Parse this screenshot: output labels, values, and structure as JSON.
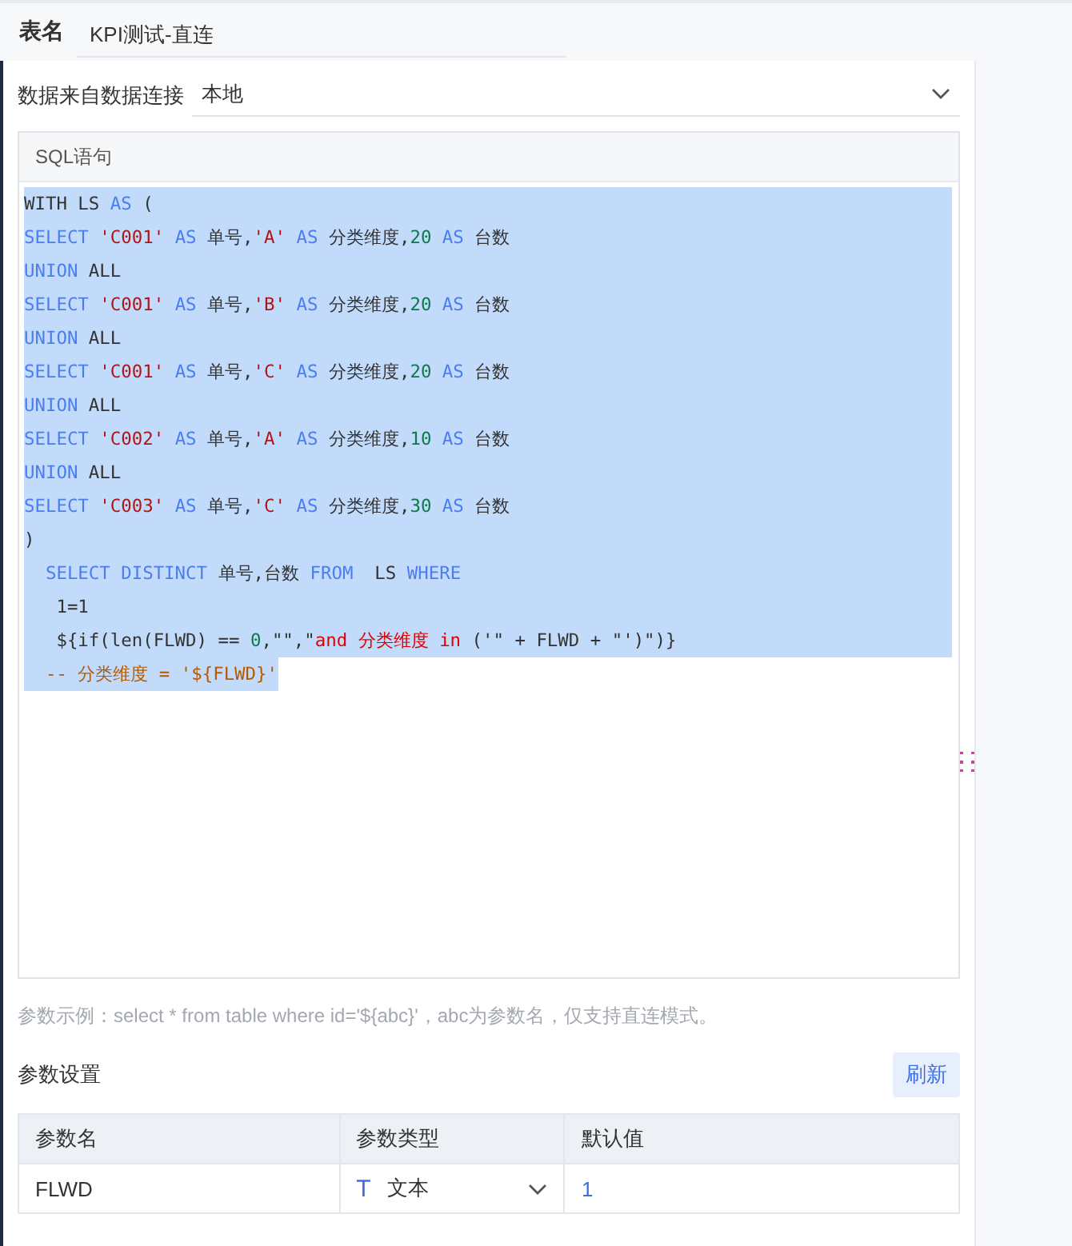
{
  "header": {
    "label": "表名",
    "value": "KPI测试-直连"
  },
  "connection": {
    "label": "数据来自数据连接",
    "value": "本地"
  },
  "sql": {
    "title": "SQL语句",
    "lines": [
      {
        "selected": true,
        "tokens": [
          {
            "color": "#333333",
            "text": "WITH LS "
          },
          {
            "color": "#4a7ef0",
            "text": "AS "
          },
          {
            "color": "#333333",
            "text": "("
          }
        ]
      },
      {
        "selected": true,
        "tokens": [
          {
            "color": "#4a7ef0",
            "text": "SELECT "
          },
          {
            "color": "#b01414",
            "text": "'C001' "
          },
          {
            "color": "#4a7ef0",
            "text": "AS "
          },
          {
            "color": "#333333",
            "text": "单号,"
          },
          {
            "color": "#b01414",
            "text": "'A' "
          },
          {
            "color": "#4a7ef0",
            "text": "AS "
          },
          {
            "color": "#333333",
            "text": "分类维度,"
          },
          {
            "color": "#0a7a4a",
            "text": "20 "
          },
          {
            "color": "#4a7ef0",
            "text": "AS "
          },
          {
            "color": "#333333",
            "text": "台数"
          }
        ]
      },
      {
        "selected": true,
        "tokens": [
          {
            "color": "#4a7ef0",
            "text": "UNION "
          },
          {
            "color": "#333333",
            "text": "ALL"
          }
        ]
      },
      {
        "selected": true,
        "tokens": [
          {
            "color": "#4a7ef0",
            "text": "SELECT "
          },
          {
            "color": "#b01414",
            "text": "'C001' "
          },
          {
            "color": "#4a7ef0",
            "text": "AS "
          },
          {
            "color": "#333333",
            "text": "单号,"
          },
          {
            "color": "#b01414",
            "text": "'B' "
          },
          {
            "color": "#4a7ef0",
            "text": "AS "
          },
          {
            "color": "#333333",
            "text": "分类维度,"
          },
          {
            "color": "#0a7a4a",
            "text": "20 "
          },
          {
            "color": "#4a7ef0",
            "text": "AS "
          },
          {
            "color": "#333333",
            "text": "台数"
          }
        ]
      },
      {
        "selected": true,
        "tokens": [
          {
            "color": "#4a7ef0",
            "text": "UNION "
          },
          {
            "color": "#333333",
            "text": "ALL"
          }
        ]
      },
      {
        "selected": true,
        "tokens": [
          {
            "color": "#4a7ef0",
            "text": "SELECT "
          },
          {
            "color": "#b01414",
            "text": "'C001' "
          },
          {
            "color": "#4a7ef0",
            "text": "AS "
          },
          {
            "color": "#333333",
            "text": "单号,"
          },
          {
            "color": "#b01414",
            "text": "'C' "
          },
          {
            "color": "#4a7ef0",
            "text": "AS "
          },
          {
            "color": "#333333",
            "text": "分类维度,"
          },
          {
            "color": "#0a7a4a",
            "text": "20 "
          },
          {
            "color": "#4a7ef0",
            "text": "AS "
          },
          {
            "color": "#333333",
            "text": "台数"
          }
        ]
      },
      {
        "selected": true,
        "tokens": [
          {
            "color": "#4a7ef0",
            "text": "UNION "
          },
          {
            "color": "#333333",
            "text": "ALL"
          }
        ]
      },
      {
        "selected": true,
        "tokens": [
          {
            "color": "#4a7ef0",
            "text": "SELECT "
          },
          {
            "color": "#b01414",
            "text": "'C002' "
          },
          {
            "color": "#4a7ef0",
            "text": "AS "
          },
          {
            "color": "#333333",
            "text": "单号,"
          },
          {
            "color": "#b01414",
            "text": "'A' "
          },
          {
            "color": "#4a7ef0",
            "text": "AS "
          },
          {
            "color": "#333333",
            "text": "分类维度,"
          },
          {
            "color": "#0a7a4a",
            "text": "10 "
          },
          {
            "color": "#4a7ef0",
            "text": "AS "
          },
          {
            "color": "#333333",
            "text": "台数"
          }
        ]
      },
      {
        "selected": true,
        "tokens": [
          {
            "color": "#4a7ef0",
            "text": "UNION "
          },
          {
            "color": "#333333",
            "text": "ALL"
          }
        ]
      },
      {
        "selected": true,
        "tokens": [
          {
            "color": "#4a7ef0",
            "text": "SELECT "
          },
          {
            "color": "#b01414",
            "text": "'C003' "
          },
          {
            "color": "#4a7ef0",
            "text": "AS "
          },
          {
            "color": "#333333",
            "text": "单号,"
          },
          {
            "color": "#b01414",
            "text": "'C' "
          },
          {
            "color": "#4a7ef0",
            "text": "AS "
          },
          {
            "color": "#333333",
            "text": "分类维度,"
          },
          {
            "color": "#0a7a4a",
            "text": "30 "
          },
          {
            "color": "#4a7ef0",
            "text": "AS "
          },
          {
            "color": "#333333",
            "text": "台数"
          }
        ]
      },
      {
        "selected": true,
        "tokens": [
          {
            "color": "#333333",
            "text": ")"
          }
        ]
      },
      {
        "selected": true,
        "tokens": [
          {
            "color": "#4a7ef0",
            "text": "  SELECT DISTINCT "
          },
          {
            "color": "#333333",
            "text": "单号,台数 "
          },
          {
            "color": "#4a7ef0",
            "text": "FROM "
          },
          {
            "color": "#333333",
            "text": " LS "
          },
          {
            "color": "#4a7ef0",
            "text": "WHERE"
          }
        ]
      },
      {
        "selected": true,
        "tokens": [
          {
            "color": "#333333",
            "text": "   1=1"
          }
        ]
      },
      {
        "selected": true,
        "tokens": [
          {
            "color": "#333333",
            "text": "   ${if(len(FLWD) == "
          },
          {
            "color": "#0a7a4a",
            "text": "0"
          },
          {
            "color": "#333333",
            "text": ",\"\",\""
          },
          {
            "color": "#e00000",
            "text": "and 分类维度 in "
          },
          {
            "color": "#333333",
            "text": "('\" + FLWD + \"')\")}"
          }
        ]
      },
      {
        "selected": true,
        "tokens": [
          {
            "color": "#b55a00",
            "text": "  -- 分类维度 = '${FLWD}'"
          }
        ]
      }
    ]
  },
  "hint": "参数示例：select * from table where id='${abc}'，abc为参数名，仅支持直连模式。",
  "params": {
    "title": "参数设置",
    "refresh": "刷新",
    "columns": [
      "参数名",
      "参数类型",
      "默认值"
    ],
    "rows": [
      {
        "name": "FLWD",
        "type_icon": "T",
        "type": "文本",
        "default": "1"
      }
    ]
  }
}
